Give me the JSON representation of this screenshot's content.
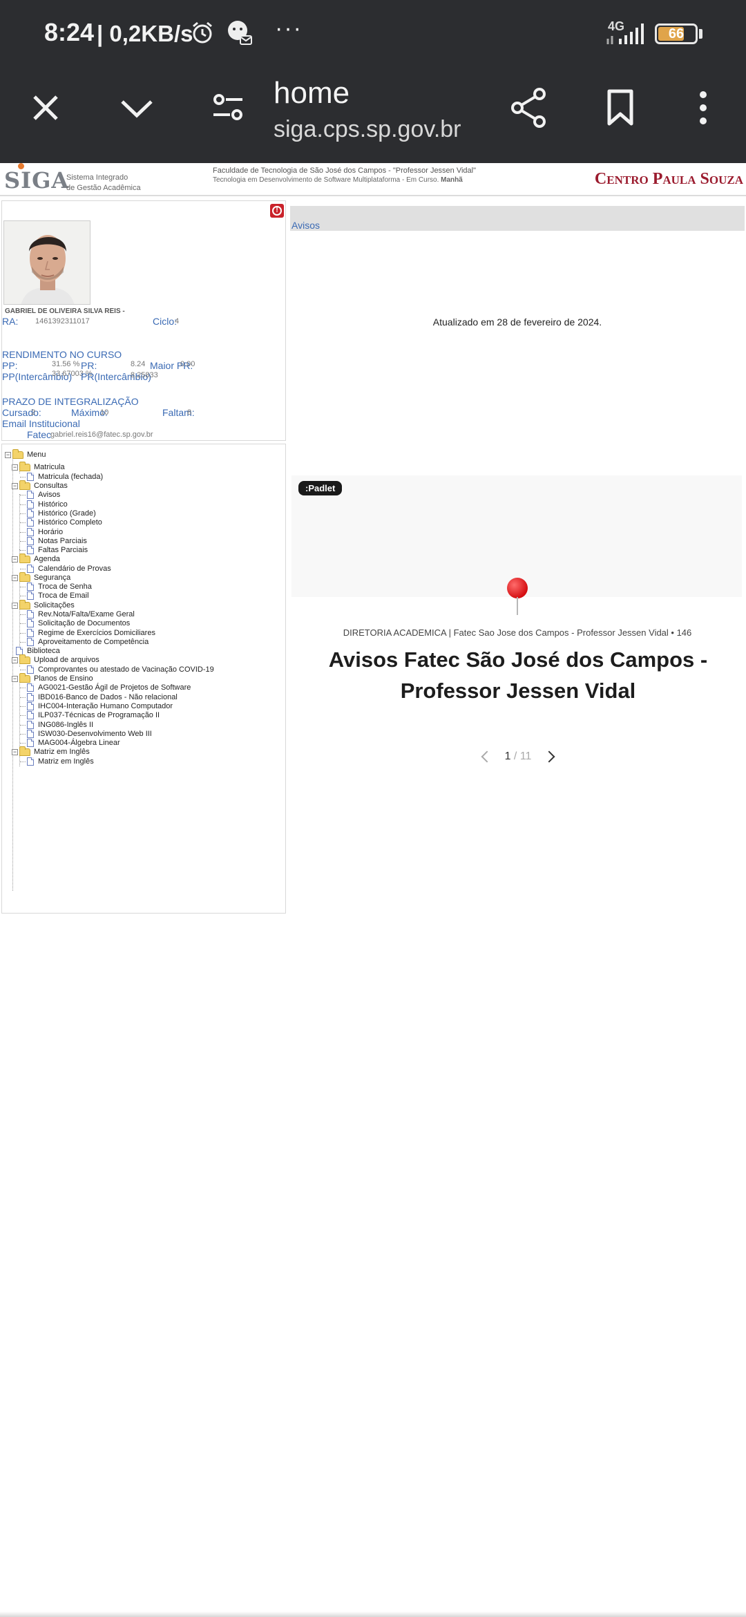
{
  "status_bar": {
    "time": "8:24",
    "network_speed": "| 0,2KB/s",
    "more": "···",
    "network_type": "4G",
    "battery_level": "66"
  },
  "browser": {
    "page_title": "home",
    "host": "siga.cps.sp.gov.br"
  },
  "siga_header": {
    "logo": "SIGA",
    "subtitle_1": "Sistema Integrado",
    "subtitle_2": "de Gestão Acadêmica",
    "institution": "Faculdade de Tecnologia de São José dos Campos - \"Professor Jessen Vidal\"",
    "course_prefix": "Tecnologia em Desenvolvimento de Software Multiplataforma -  Em Curso.",
    "course_shift": "Manhã",
    "partner_logo": "Centro Paula Souza"
  },
  "student": {
    "name": "GABRIEL DE OLIVEIRA SILVA REIS -",
    "ra_label": "RA:",
    "ra_value": "1461392311017",
    "cycle_label": "Ciclo:",
    "cycle_value": "4",
    "performance_title": "RENDIMENTO NO CURSO",
    "pp_label": "PP:",
    "pp_value": "31.56 %",
    "pr_label": "PR:",
    "pr_value": "8.24",
    "max_pr_label": "Maior PR:",
    "max_pr_value": "0.00",
    "pp_exchange_label": "PP(Intercâmbio)",
    "pp_exchange_value": "33,67003 %",
    "pr_exchange_label": "PR(Intercâmbio)",
    "pr_exchange_value": "8,25833",
    "deadline_title": "PRAZO DE INTEGRALIZAÇÃO",
    "attended_label": "Cursado:",
    "attended_value": "2",
    "maximum_label": "Máximo:",
    "maximum_value": "10",
    "remaining_label": "Faltam:",
    "remaining_value": "8",
    "email_title": "Email Institucional",
    "email_label": "Fatec",
    "email_value": "gabriel.reis16@fatec.sp.gov.br"
  },
  "menu": {
    "root": "Menu",
    "matricula": "Matricula",
    "matricula_fechada": "Matricula (fechada)",
    "consultas": "Consultas",
    "avisos": "Avisos",
    "historico": "Histórico",
    "historico_grade": "Histórico (Grade)",
    "historico_completo": "Histórico Completo",
    "horario": "Horário",
    "notas_parciais": "Notas Parciais",
    "faltas_parciais": "Faltas Parciais",
    "agenda": "Agenda",
    "calendario": "Calendário de Provas",
    "seguranca": "Segurança",
    "troca_senha": "Troca de Senha",
    "troca_email": "Troca de Email",
    "solicitacoes": "Solicitações",
    "rev_nota": "Rev.Nota/Falta/Exame Geral",
    "solic_documentos": "Solicitação de Documentos",
    "regime": "Regime de Exercícios Domiciliares",
    "aproveitamento": "Aproveitamento de Competência",
    "biblioteca": "Biblioteca",
    "upload": "Upload de arquivos",
    "comprovantes": "Comprovantes ou atestado de Vacinação COVID-19",
    "planos": "Planos de Ensino",
    "ag0021": "AG0021-Gestão Ágil de Projetos de Software",
    "ibd016": "IBD016-Banco de Dados - Não relacional",
    "ihc004": "IHC004-Interação Humano Computador",
    "ilp037": "ILP037-Técnicas de Programação II",
    "ing086": "ING086-Inglês II",
    "isw030": "ISW030-Desenvolvimento Web III",
    "mag004": "MAG004-Álgebra Linear",
    "matriz_ingles": "Matriz em Inglês",
    "matriz_ingles_item": "Matriz em Inglês"
  },
  "content": {
    "avisos_link": "Avisos",
    "updated_text": "Atualizado em 28 de fevereiro de 2024.",
    "padlet_tag": ":Padlet",
    "padlet_meta": "DIRETORIA ACADEMICA | Fatec Sao Jose dos Campos - Professor Jessen Vidal • 146",
    "padlet_title": "Avisos Fatec São José dos Campos - Professor Jessen Vidal",
    "page_current": "1",
    "page_total": "/ 11"
  },
  "icons": {
    "close": "close-icon",
    "collapse": "chevron-down-icon",
    "tune": "tune-icon",
    "share": "share-icon",
    "bookmark": "bookmark-icon",
    "overflow": "more-vert-icon"
  }
}
